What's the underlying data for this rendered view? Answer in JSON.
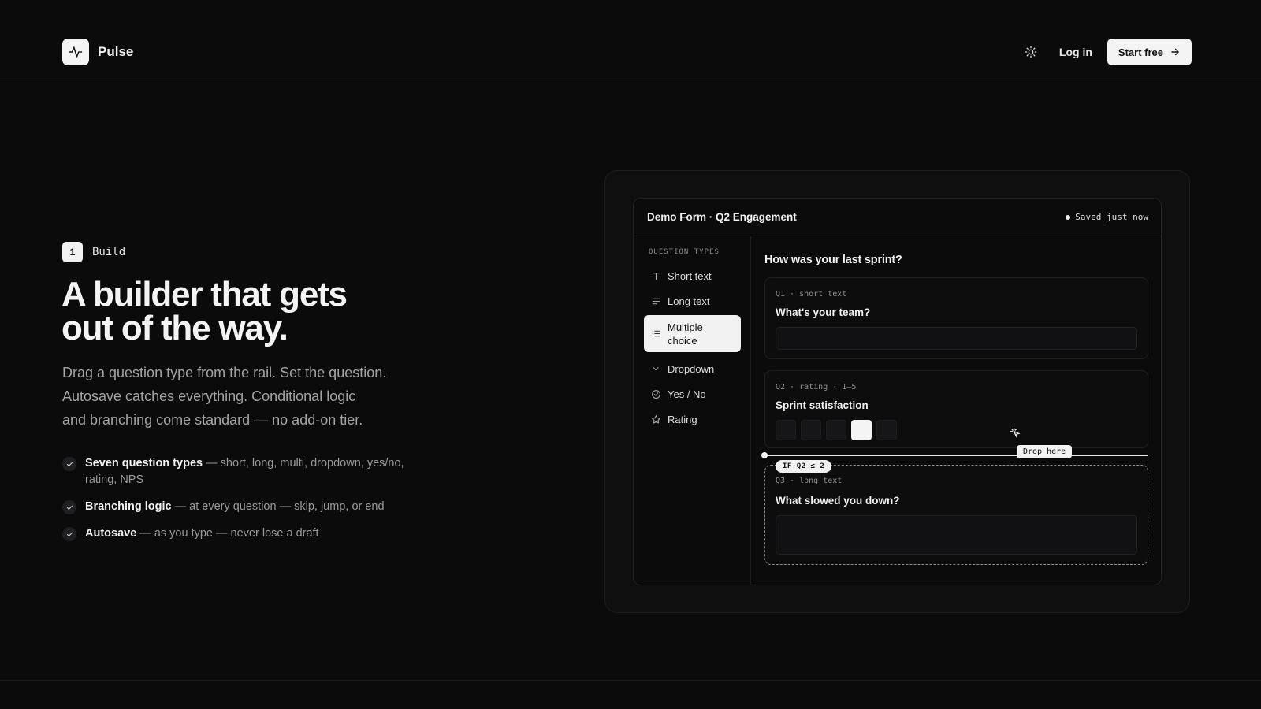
{
  "brand": {
    "name": "Pulse",
    "logo_icon": "pulse-icon"
  },
  "header": {
    "theme_icon": "sun-icon",
    "login_label": "Log in",
    "start_label": "Start free",
    "start_icon": "arrow-right-icon"
  },
  "hero": {
    "step_number": "1",
    "step_label": "Build",
    "headline_line1": "A builder that gets",
    "headline_line2": "out of the way.",
    "lede_line1": "Drag a question type from the rail. Set the question.",
    "lede_line2": "Autosave catches everything. Conditional logic",
    "lede_line3": "and branching come standard — no add-on tier.",
    "features": [
      {
        "title": "Seven question types",
        "text": " — short, long, multi, dropdown, yes/no, rating, NPS"
      },
      {
        "title": "Branching logic",
        "text": " — at every question — skip, jump, or end"
      },
      {
        "title": "Autosave",
        "text": " — as you type — never lose a draft"
      }
    ]
  },
  "demo": {
    "title": "Demo Form · Q2 Engagement",
    "saved": "Saved just now",
    "rail_heading": "QUESTION TYPES",
    "rail_items": [
      {
        "label": "Short text",
        "icon": "text-icon"
      },
      {
        "label": "Long text",
        "icon": "paragraph-icon"
      },
      {
        "label": "Multiple choice",
        "icon": "list-icon"
      },
      {
        "label": "Dropdown",
        "icon": "chevron-down-icon"
      },
      {
        "label": "Yes / No",
        "icon": "check-circle-icon"
      },
      {
        "label": "Rating",
        "icon": "star-icon"
      }
    ],
    "form_question": "How was your last sprint?",
    "q1": {
      "meta": "Q1 · short text",
      "title": "What's your team?"
    },
    "q2": {
      "meta": "Q2 · rating · 1–5",
      "title": "Sprint satisfaction",
      "selected": 4,
      "scale": 5
    },
    "drop_hint": "Drop here",
    "condition": "IF Q2 ≤ 2",
    "q3": {
      "meta": "Q3 · long text",
      "title": "What slowed you down?"
    }
  }
}
